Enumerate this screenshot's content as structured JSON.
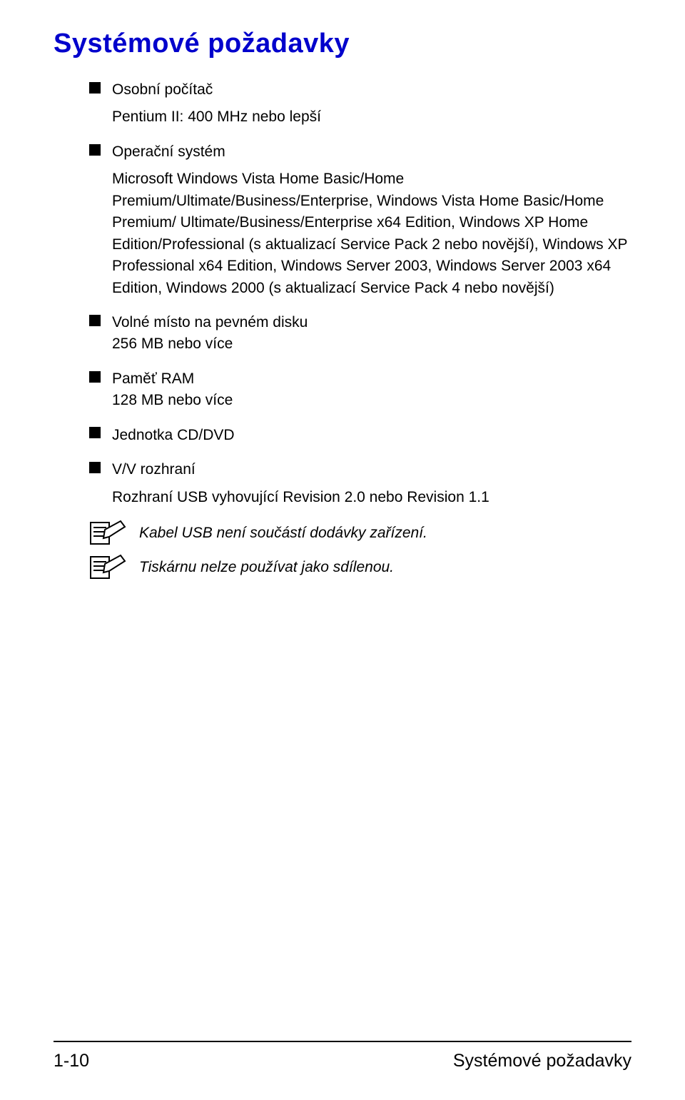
{
  "title": "Systémové požadavky",
  "items": [
    {
      "label": "Osobní počítač",
      "detail": "Pentium II: 400 MHz nebo lepší"
    },
    {
      "label": "Operační systém",
      "detail": "Microsoft Windows Vista Home Basic/Home Premium/Ultimate/Business/Enterprise, Windows Vista Home Basic/Home Premium/ Ultimate/Business/Enterprise x64 Edition, Windows XP Home Edition/Professional (s aktualizací Service Pack 2 nebo novější), Windows XP Professional x64 Edition, Windows Server 2003, Windows Server 2003 x64 Edition, Windows 2000 (s aktualizací Service Pack 4 nebo novější)"
    },
    {
      "label": "Volné místo na pevném disku",
      "detail_inline": "256 MB nebo více"
    },
    {
      "label": "Paměť RAM",
      "detail_inline": "128 MB nebo více"
    },
    {
      "label": "Jednotka CD/DVD"
    },
    {
      "label": "V/V rozhraní",
      "detail": "Rozhraní USB vyhovující Revision 2.0 nebo Revision 1.1"
    }
  ],
  "notes": [
    "Kabel USB není součástí dodávky zařízení.",
    "Tiskárnu nelze používat jako sdílenou."
  ],
  "footer": {
    "left": "1-10",
    "right": "Systémové požadavky"
  }
}
